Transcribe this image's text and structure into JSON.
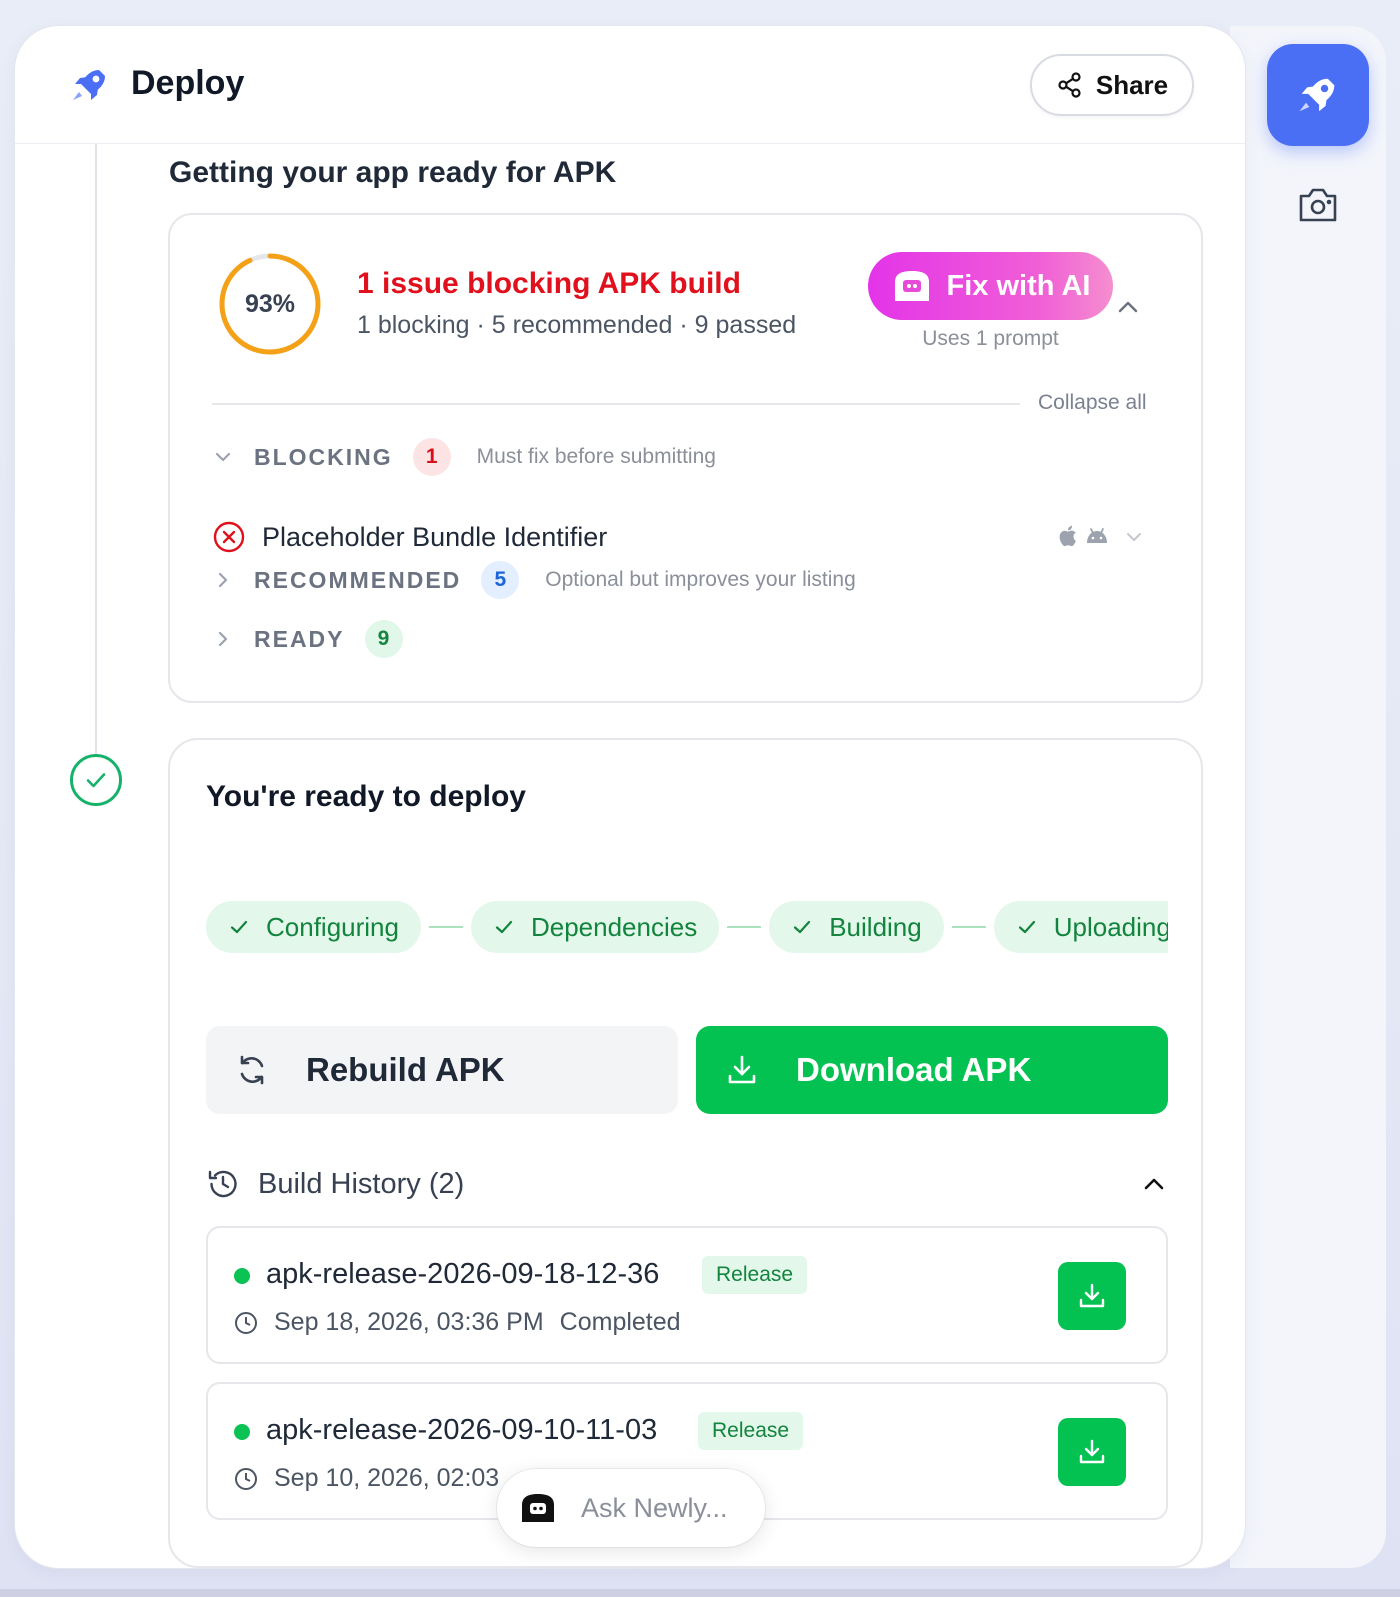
{
  "header": {
    "title": "Deploy",
    "share_label": "Share"
  },
  "section": {
    "title": "Getting your app ready for APK"
  },
  "checks": {
    "progress_percent": 93,
    "progress_label": "93%",
    "issue_title": "1 issue blocking APK build",
    "issue_summary": "1 blocking · 5 recommended · 9 passed",
    "fix_button": "Fix with AI",
    "fix_subtext": "Uses 1 prompt",
    "collapse_all": "Collapse all",
    "groups": [
      {
        "label": "BLOCKING",
        "count": "1",
        "desc": "Must fix before submitting"
      },
      {
        "label": "RECOMMENDED",
        "count": "5",
        "desc": "Optional but improves your listing"
      },
      {
        "label": "READY",
        "count": "9",
        "desc": ""
      }
    ],
    "blocking_items": [
      {
        "name": "Placeholder Bundle Identifier"
      }
    ]
  },
  "deploy": {
    "title": "You're ready to deploy",
    "steps": [
      "Configuring",
      "Dependencies",
      "Building",
      "Uploading"
    ],
    "rebuild_label": "Rebuild APK",
    "download_label": "Download APK",
    "history_title": "Build History (2)",
    "builds": [
      {
        "name": "apk-release-2026-09-18-12-36",
        "badge": "Release",
        "date": "Sep 18, 2026, 03:36 PM",
        "status": "Completed"
      },
      {
        "name": "apk-release-2026-09-10-11-03",
        "badge": "Release",
        "date": "Sep 10, 2026, 02:03",
        "status": ""
      }
    ]
  },
  "assistant": {
    "placeholder": "Ask Newly..."
  },
  "colors": {
    "accent": "#4a6ff5",
    "success": "#04c252",
    "danger": "#e0111c",
    "ai_gradient_start": "#e334e8"
  }
}
